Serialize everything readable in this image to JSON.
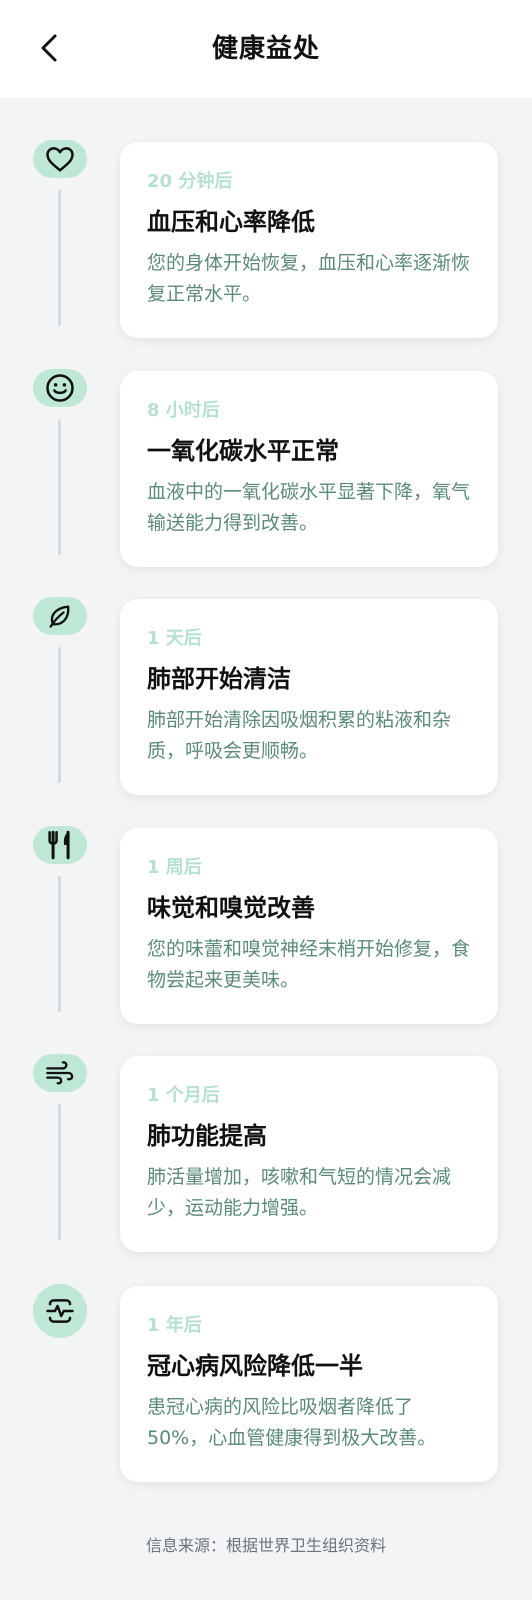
{
  "header": {
    "title": "健康益处"
  },
  "colors": {
    "accent": "#bfe7d6",
    "time_text": "#b6e0cf",
    "desc_text": "#5b8a7a",
    "timeline_line": "#d3d9dd",
    "background": "#f3f4f6"
  },
  "benefits": [
    {
      "time": "20 分钟后",
      "title": "血压和心率降低",
      "desc": "您的身体开始恢复，血压和心率逐渐恢复正常水平。",
      "icon": "heart-icon"
    },
    {
      "time": "8 小时后",
      "title": "一氧化碳水平正常",
      "desc": "血液中的一氧化碳水平显著下降，氧气输送能力得到改善。",
      "icon": "smile-icon"
    },
    {
      "time": "1 天后",
      "title": "肺部开始清洁",
      "desc": "肺部开始清除因吸烟积累的粘液和杂质，呼吸会更顺畅。",
      "icon": "leaf-icon"
    },
    {
      "time": "1 周后",
      "title": "味觉和嗅觉改善",
      "desc": "您的味蕾和嗅觉神经末梢开始修复，食物尝起来更美味。",
      "icon": "utensils-icon"
    },
    {
      "time": "1 个月后",
      "title": "肺功能提高",
      "desc": "肺活量增加，咳嗽和气短的情况会减少，运动能力增强。",
      "icon": "wind-icon"
    },
    {
      "time": "1 年后",
      "title": "冠心病风险降低一半",
      "desc": "患冠心病的风险比吸烟者降低了50%，心血管健康得到极大改善。",
      "icon": "heart-pulse-icon"
    }
  ],
  "footer": {
    "source": "信息来源：根据世界卫生组织资料"
  }
}
